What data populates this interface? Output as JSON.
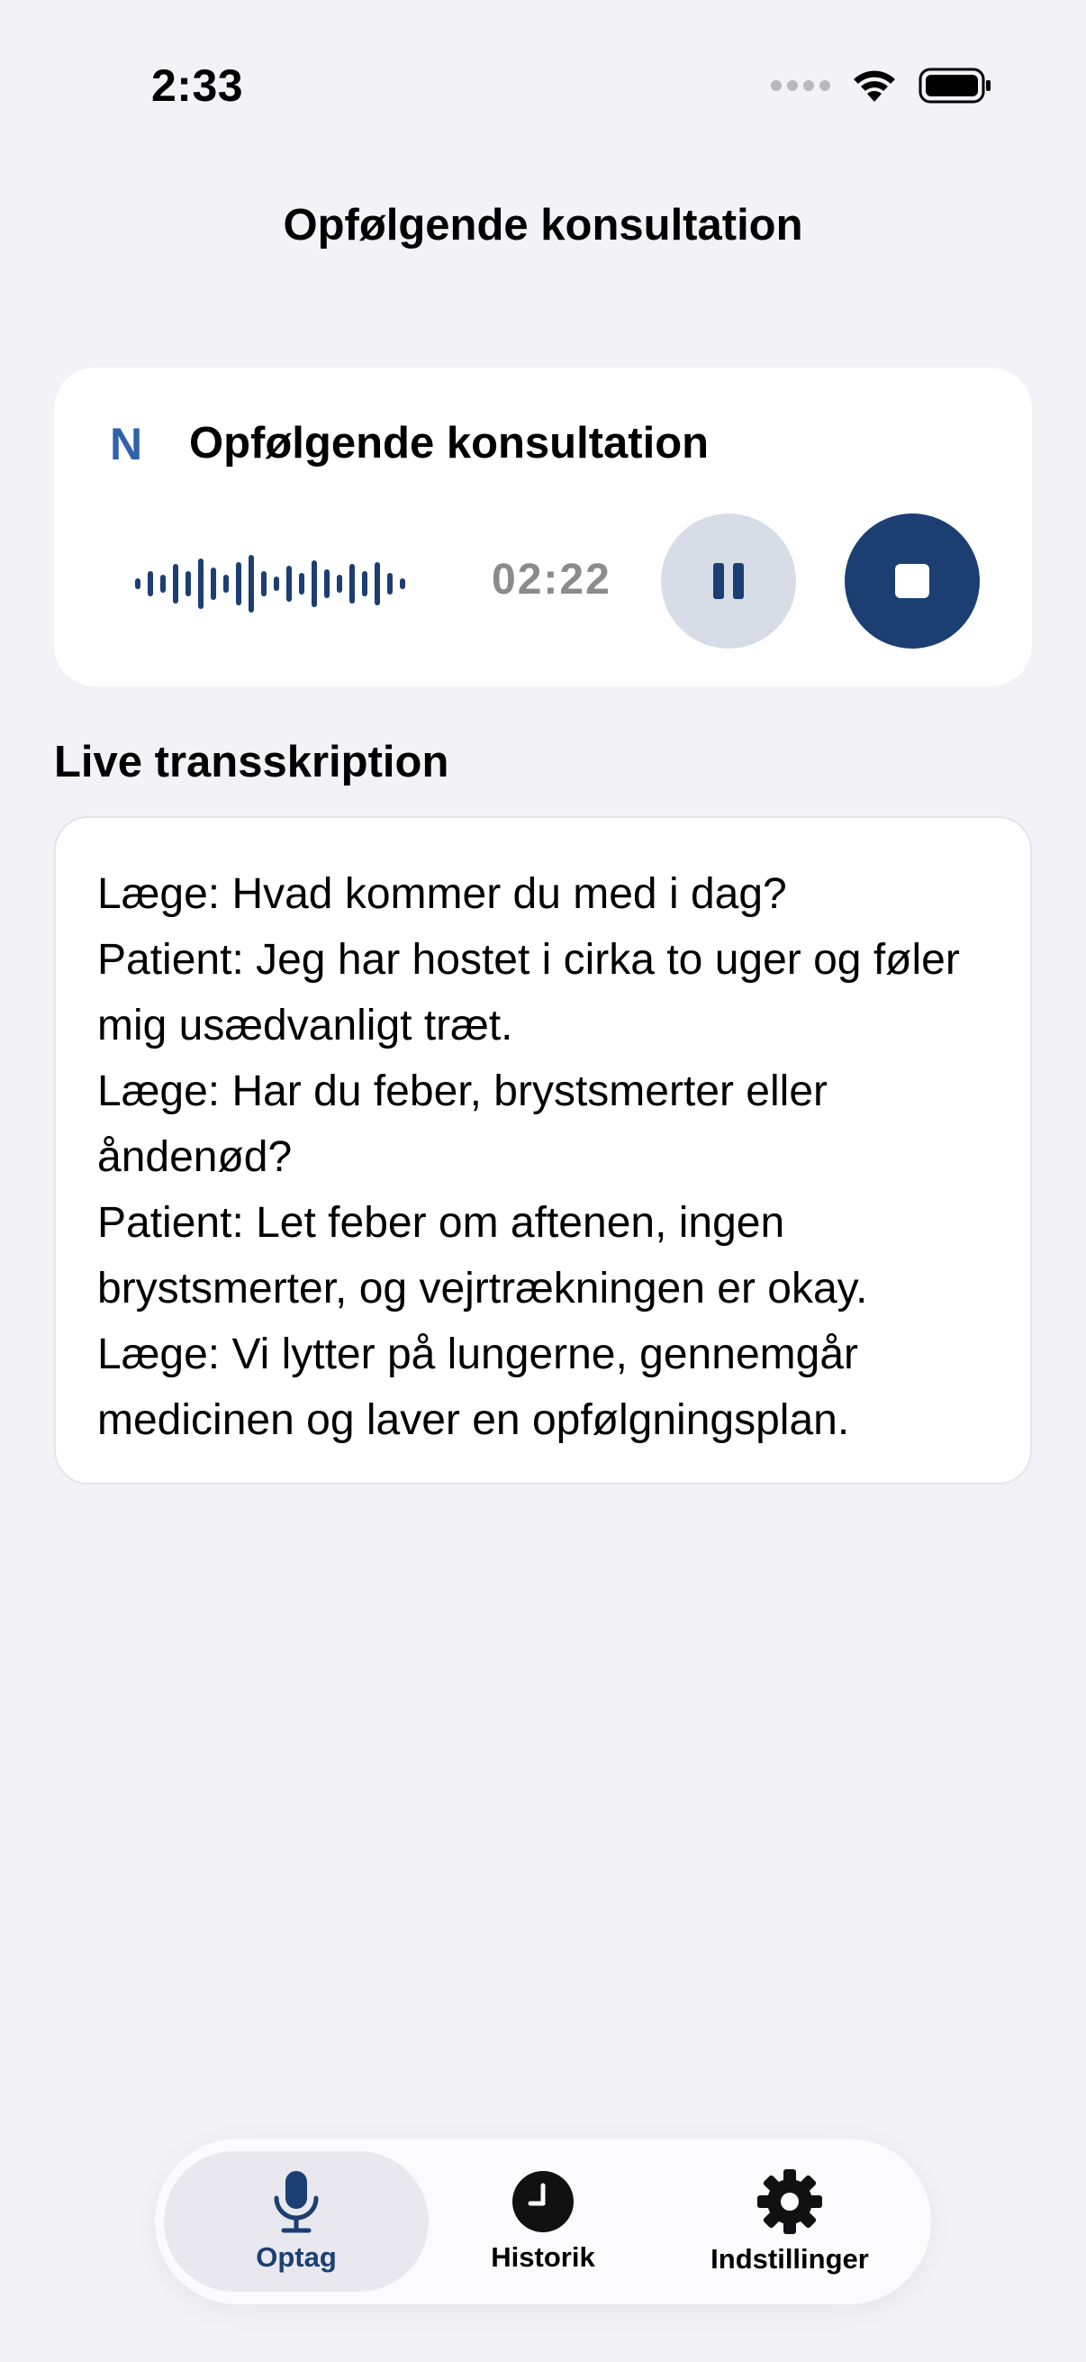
{
  "status_bar": {
    "time": "2:33",
    "signal_icon": "signal-dots-icon",
    "wifi_icon": "wifi-icon",
    "battery_icon": "battery-icon"
  },
  "nav": {
    "title": "Opfølgende konsultation"
  },
  "recording": {
    "logo_letter": "N",
    "title": "Opfølgende konsultation",
    "elapsed": "02:22",
    "pause_icon": "pause-icon",
    "stop_icon": "stop-icon"
  },
  "transcription": {
    "heading": "Live transskription",
    "lines": [
      "Læge: Hvad kommer du med i dag?",
      "Patient: Jeg har hostet i cirka to uger og føler mig usædvanligt træt.",
      "Læge: Har du feber, brystsmerter eller åndenød?",
      "Patient: Let feber om aftenen, ingen brystsmerter, og vejrtrækningen er okay.",
      "Læge: Vi lytter på lungerne, gennemgår medicinen og laver en opfølgningsplan."
    ]
  },
  "tabs": [
    {
      "label": "Optag",
      "icon": "microphone-icon",
      "active": true
    },
    {
      "label": "Historik",
      "icon": "clock-icon",
      "active": false
    },
    {
      "label": "Indstillinger",
      "icon": "gear-icon",
      "active": false
    }
  ],
  "colors": {
    "accent": "#1b3f73",
    "logo": "#2f62ac",
    "pause_bg": "#d7dde6",
    "background": "#f2f2f7"
  }
}
